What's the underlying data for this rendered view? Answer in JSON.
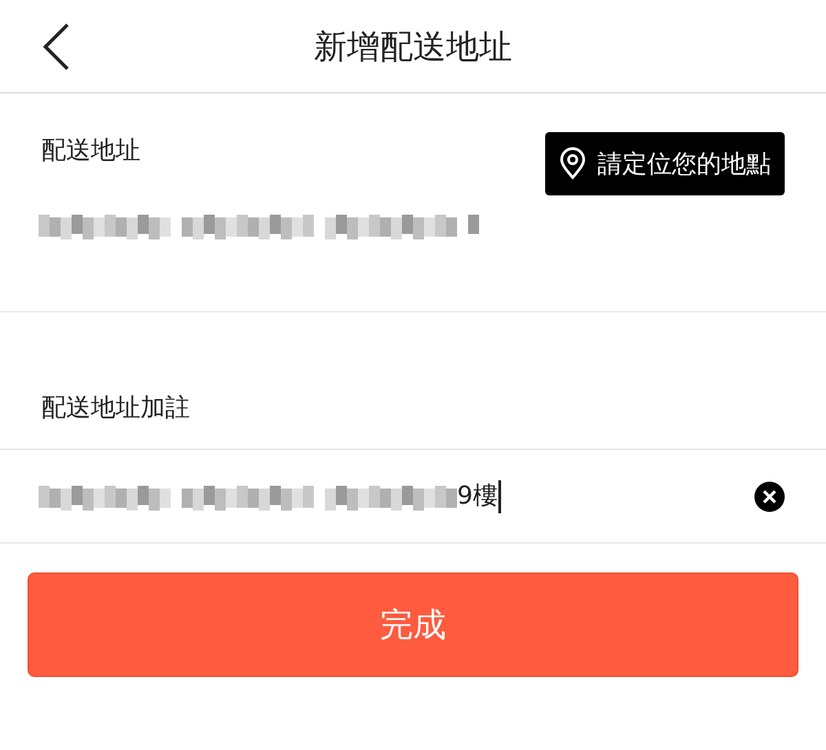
{
  "header": {
    "back_icon": true,
    "title": "新增配送地址"
  },
  "address": {
    "label": "配送地址",
    "locate_button": "請定位您的地點",
    "value_redacted": true
  },
  "note": {
    "label": "配送地址加註",
    "value_redacted": true,
    "value": "9樓",
    "focused": true,
    "clear_button": true
  },
  "submit_button": "完成"
}
